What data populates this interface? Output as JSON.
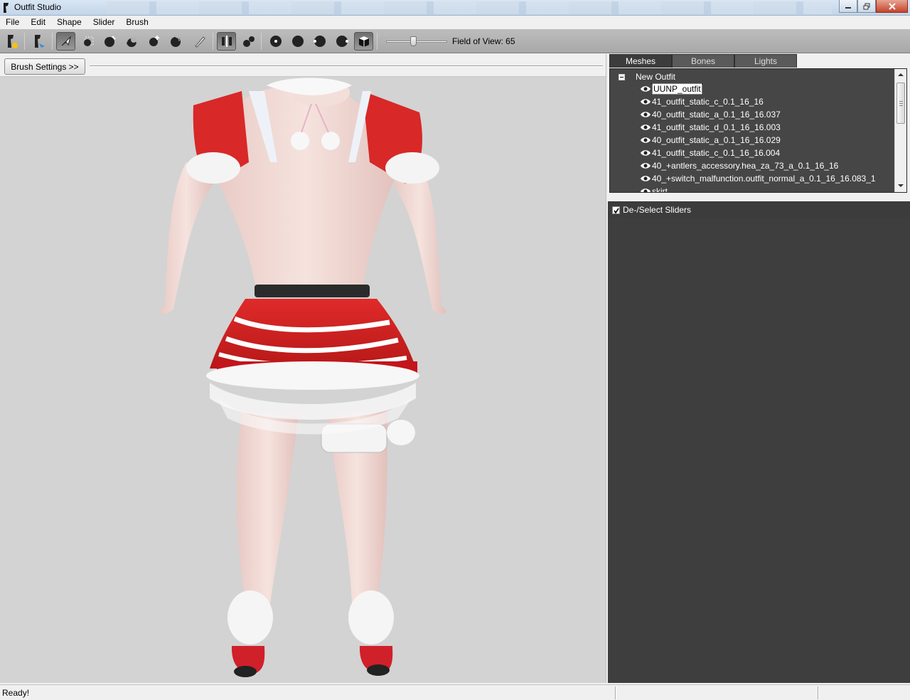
{
  "window": {
    "title": "Outfit Studio"
  },
  "menu": [
    "File",
    "Edit",
    "Shape",
    "Slider",
    "Brush"
  ],
  "toolbar": {
    "fov_label": "Field of View: 65",
    "fov_value": 65,
    "tools": [
      "mesh-import-icon",
      "mesh-export-icon",
      "select-brush-icon",
      "mask-brush-icon",
      "inflate-brush-icon",
      "deflate-brush-icon",
      "move-brush-icon",
      "smooth-brush-icon",
      "weight-paint-icon",
      "mirror-x-icon",
      "connected-brush-icon",
      "front-view-icon",
      "back-view-icon",
      "left-view-icon",
      "right-view-icon",
      "perspective-view-icon"
    ]
  },
  "viewport": {
    "brush_settings_label": "Brush Settings >>"
  },
  "panel": {
    "tabs": [
      "Meshes",
      "Bones",
      "Lights"
    ],
    "active_tab": "Meshes",
    "root_label": "New Outfit",
    "meshes": [
      "UUNP_outfit",
      "41_outfit_static_c_0.1_16_16",
      "40_outfit_static_a_0.1_16_16.037",
      "41_outfit_static_d_0.1_16_16.003",
      "40_outfit_static_a_0.1_16_16.029",
      "41_outfit_static_c_0.1_16_16.004",
      "40_+antlers_accessory.hea_za_73_a_0.1_16_16",
      "40_+switch_malfunction.outfit_normal_a_0.1_16_16.083_1",
      "skirt"
    ],
    "sliders_label": "De-/Select Sliders"
  },
  "status": {
    "text": "Ready!"
  },
  "colors": {
    "panel_dark": "#3e3e3e",
    "tree_bg": "#464646",
    "viewport_bg": "#d3d3d3",
    "toolbar_bg": "#b3b3b3"
  }
}
